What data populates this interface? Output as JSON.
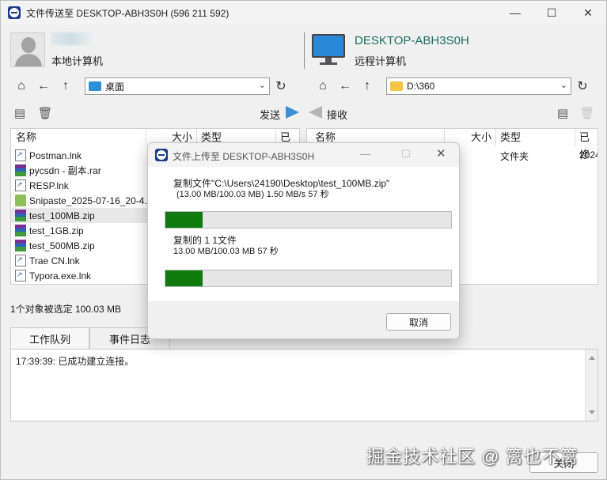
{
  "window": {
    "title": "文件传送至 DESKTOP-ABH3S0H (596 211 592)",
    "icons": [
      "teamviewer-icon",
      "minimize-icon",
      "maximize-icon",
      "close-icon"
    ]
  },
  "local": {
    "label": "本地计算机",
    "path": "桌面",
    "columns": [
      "名称",
      "大小",
      "类型",
      "已"
    ],
    "files": [
      {
        "name": "Postman.lnk",
        "icon": "shortcut"
      },
      {
        "name": "pycsdn - 副本.rar",
        "icon": "rar"
      },
      {
        "name": "RESP.lnk",
        "icon": "shortcut"
      },
      {
        "name": "Snipaste_2025-07-16_20-4...",
        "icon": "png"
      },
      {
        "name": "test_100MB.zip",
        "icon": "rar",
        "selected": true
      },
      {
        "name": "test_1GB.zip",
        "icon": "rar"
      },
      {
        "name": "test_500MB.zip",
        "icon": "rar"
      },
      {
        "name": "Trae CN.lnk",
        "icon": "shortcut"
      },
      {
        "name": "Typora.exe.lnk",
        "icon": "shortcut"
      }
    ],
    "status": "1个对象被选定  100.03 MB"
  },
  "remote": {
    "name": "DESKTOP-ABH3S0H",
    "label": "远程计算机",
    "path": "D:\\360",
    "columns": [
      "名称",
      "大小",
      "类型",
      "已修"
    ],
    "row": {
      "type": "文件夹",
      "date": "2024"
    }
  },
  "toolbar": {
    "send_label": "发送",
    "receive_label": "接收"
  },
  "tabs": [
    {
      "label": "工作队列",
      "active": false
    },
    {
      "label": "事件日志",
      "active": true
    }
  ],
  "log": {
    "line": "17:39:39: 已成功建立连接。"
  },
  "close_label": "关闭",
  "watermark": "掘金技术社区 @ 篱也不篱",
  "dialog": {
    "title": "文件上传至 DESKTOP-ABH3S0H",
    "file_line": "复制文件\"C:\\Users\\24190\\Desktop\\test_100MB.zip\"",
    "file_stats": "(13.00 MB/100.03 MB)   1.50 MB/s  57 秒",
    "file_progress": 0.13,
    "total_line": "复制的 1 1文件",
    "total_stats": "13.00 MB/100.03 MB     57 秒",
    "total_progress": 0.13,
    "cancel_label": "取消"
  },
  "colors": {
    "accent_blue": "#3b8fd8",
    "progress_green": "#0f7b0f",
    "remote_name": "#1b6f62"
  }
}
